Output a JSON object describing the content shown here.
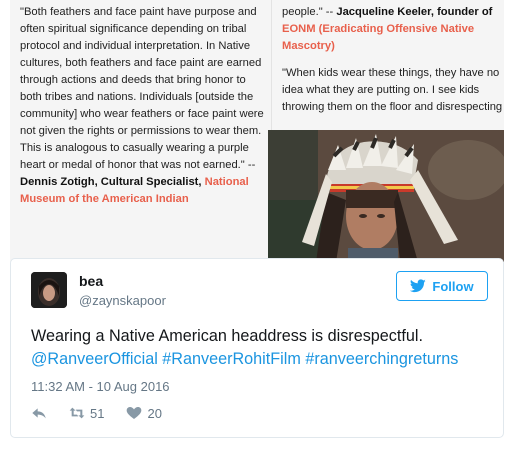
{
  "article": {
    "left_quote": {
      "text": "\"Both feathers and face paint have purpose and often spiritual significance depending on tribal protocol and individual interpretation. In Native cultures, both feathers and face paint are earned through actions and deeds that bring honor to both tribes and nations. Individuals [outside the community] who wear feathers or face paint were not given the rights or permissions to wear them. This is analogous to casually wearing a purple heart or medal of honor that was not earned.\" --",
      "author": "Dennis Zotigh, Cultural Specialist,",
      "org": "National Museum of the American Indian"
    },
    "right_quote_1": {
      "text": "people.\" --",
      "author": "Jacqueline Keeler, founder of",
      "org": "EONM (Eradicating Offensive Native Mascotry)"
    },
    "right_quote_2": {
      "text": "\"When kids wear these things, they have no idea what they are putting on. I see kids throwing them on the floor and disrespecting"
    }
  },
  "tweet": {
    "user_name": "bea",
    "user_handle": "@zaynskapoor",
    "follow_label": "Follow",
    "text_plain": "Wearing a Native American headdress is disrespectful.",
    "links": [
      "@RanveerOfficial",
      "#RanveerRohitFilm",
      "#ranveerchingreturns"
    ],
    "timestamp": "11:32 AM - 10 Aug 2016",
    "retweets": "51",
    "likes": "20"
  },
  "colors": {
    "accent_blue": "#1da1f2",
    "link_blue": "#1b95e0",
    "org_red": "#e8604c"
  },
  "icons": {
    "reply": "reply-icon",
    "retweet": "retweet-icon",
    "like": "heart-icon",
    "follow": "twitter-bird-icon"
  }
}
